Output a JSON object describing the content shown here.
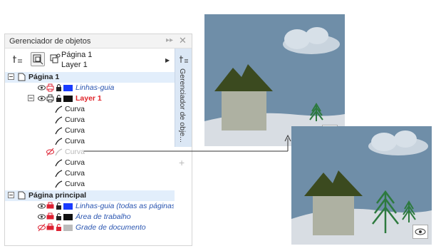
{
  "panel": {
    "title": "Gerenciador de objetos",
    "collapse_icon": "double-chevron-right-icon",
    "close_icon": "close-icon",
    "page_name": "Página 1",
    "layer_name": "Layer 1",
    "side_tab": "Gerenciador de obje..."
  },
  "tree": {
    "page1": "Página 1",
    "guides": "Linhas-guia",
    "layer1": "Layer 1",
    "curves": [
      "Curva",
      "Curva",
      "Curva",
      "Curva",
      "Curva",
      "Curva",
      "Curva",
      "Curva"
    ],
    "master": "Página principal",
    "master_guides": "Linhas-guia (todas as páginas)",
    "desktop": "Área de trabalho",
    "grid": "Grade de documento"
  },
  "colors": {
    "guides": "#1a3cff",
    "layer": "#111111",
    "desktop": "#111111",
    "grid": "#bbbbbb",
    "layer_label": "#e0242a",
    "link_label": "#2a55b0",
    "highlight_row": "#e2eefb",
    "side_tab": "#dbe7f5",
    "sky": "#6f8ea8",
    "roof": "#3b4a1f",
    "tree": "#2d7a3e"
  },
  "icons": [
    "eye-icon",
    "printer-icon",
    "lock-icon",
    "curve-icon",
    "eye-hidden-icon",
    "page-icon",
    "expand-icon"
  ]
}
